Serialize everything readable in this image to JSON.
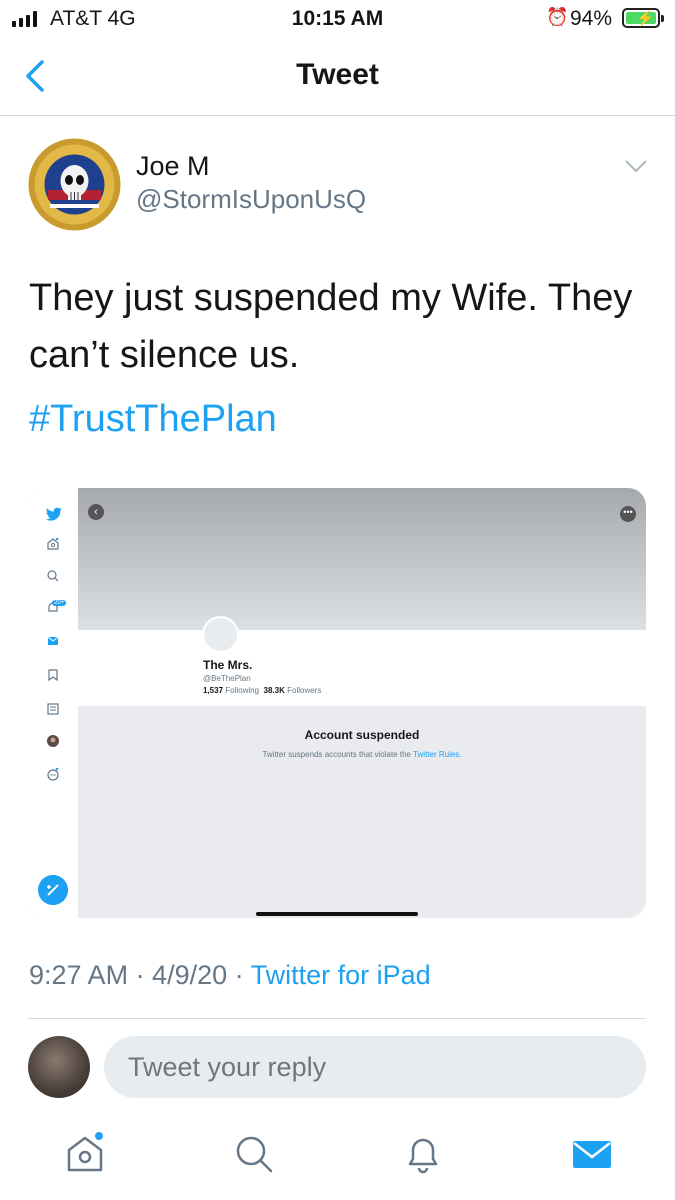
{
  "status_bar": {
    "carrier": "AT&T  4G",
    "time": "10:15 AM",
    "battery": "94%"
  },
  "nav": {
    "title": "Tweet",
    "back_icon": "chevron-left-icon"
  },
  "tweet": {
    "author_name": "Joe M",
    "author_handle": "@StormIsUponUsQ",
    "text": "They just suspended my Wife. They can’t silence us.",
    "hashtag": "#TrustThePlan",
    "timestamp": "9:27 AM · 4/9/20 · ",
    "source": "Twitter for iPad"
  },
  "embedded": {
    "profile_name": "The Mrs.",
    "profile_handle": "@BeThePlan",
    "following_count": "1,537",
    "following_label": "Following",
    "followers_count": "38.3K",
    "followers_label": "Followers",
    "notif_badge": "20+",
    "suspended_title": "Account suspended",
    "suspended_desc": "Twitter suspends accounts that violate the ",
    "rules_link": "Twitter Rules."
  },
  "reply": {
    "placeholder": "Tweet your reply"
  },
  "tabs": [
    "home-icon",
    "search-icon",
    "notifications-icon",
    "messages-icon"
  ],
  "colors": {
    "accent": "#1da1f2",
    "text": "#14171a",
    "secondary": "#657786",
    "battery": "#4cd964"
  }
}
